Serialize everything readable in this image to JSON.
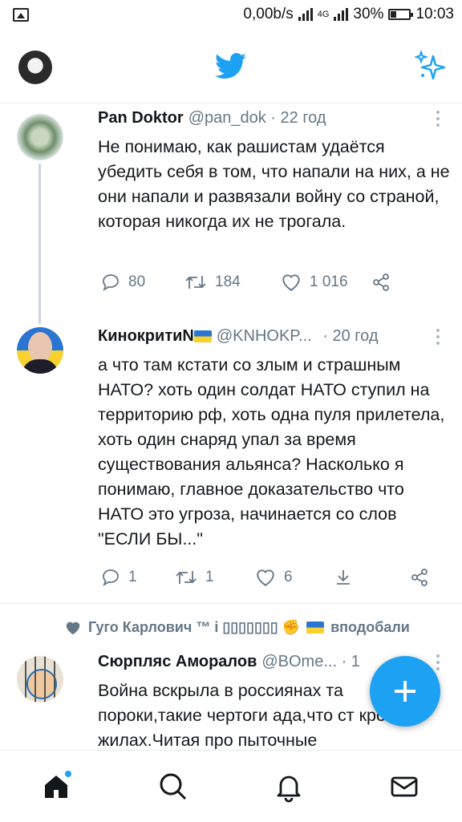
{
  "status_bar": {
    "net_speed": "0,00b/s",
    "network_type": "4G",
    "battery": "30%",
    "time": "10:03"
  },
  "tweets": [
    {
      "name": "Pan Doktor",
      "handle": "@pan_dok",
      "time": "· 22 год",
      "text": "Не понимаю, как рашистам удаётся убедить себя в том, что напали на них, а не они напали и развязали войну со страной, которая никогда их не трогала.",
      "replies": "80",
      "retweets": "184",
      "likes": "1 016"
    },
    {
      "name": "КинокритиN",
      "handle": "@KNHOKP...",
      "time": "· 20 год",
      "text": "а что там кстати со злым и страшным НАТО? хоть один солдат НАТО ступил на территорию рф, хоть одна пуля прилетела, хоть один снаряд упал за время существования альянса? Насколько я понимаю, главное доказательство что НАТО это угроза, начинается со слов \"ЕСЛИ БЫ...\"",
      "replies": "1",
      "retweets": "1",
      "likes": "6"
    },
    {
      "liked_by": "Гуго Карлович ™ і ▯▯▯▯▯▯▯ ✊",
      "liked_suffix": "вподобали",
      "name": "Сюрпляс Аморалов",
      "handle": "@BOme...",
      "time": "· 1",
      "text": "Война вскрыла в россиянах та пороки,такие чертоги ада,что ст кровь в жилах.Читая про пыточные"
    }
  ],
  "colors": {
    "accent": "#1da1f2",
    "text": "#14171a",
    "secondary": "#657786"
  }
}
